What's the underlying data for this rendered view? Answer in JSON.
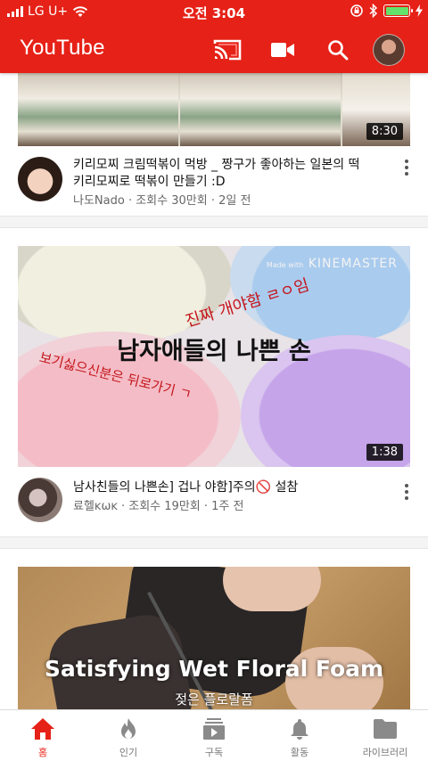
{
  "status_bar": {
    "carrier": "LG U+",
    "time": "오전 3:04"
  },
  "app_bar": {
    "title": "YouTube",
    "icons": [
      "cast-icon",
      "camera-icon",
      "search-icon",
      "account-avatar"
    ]
  },
  "colors": {
    "brand_red": "#e62117",
    "text_primary": "#111111",
    "text_secondary": "#666666"
  },
  "videos": [
    {
      "duration": "8:30",
      "title": "키리모찌 크림떡볶이 먹방 _ 짱구가 좋아하는 일본의 떡 키리모찌로 떡볶이 만들기 :D",
      "subtitle": "나도Nado · 조회수 30만회 · 2일 전"
    },
    {
      "duration": "1:38",
      "title": "남사친들의 나쁜손] 겁나 야함]주의🚫 설참",
      "subtitle": "료헬ĸωĸ · 조회수 19만회 · 1주 전",
      "thumbnail_text": {
        "main": "남자애들의 나쁜 손",
        "red_top": "진짜 개야함 ㄹㅇ임",
        "red_left": "보기싫으신분은 뒤로가기 ㄱ",
        "watermark_small": "Made with",
        "watermark": "KINEMASTER"
      }
    },
    {
      "thumbnail_text": {
        "main": "Satisfying Wet Floral Foam",
        "sub": "젖은 플로랄폼"
      }
    }
  ],
  "bottom_nav": [
    {
      "label": "홈",
      "icon": "home-icon",
      "active": true
    },
    {
      "label": "인기",
      "icon": "flame-icon",
      "active": false
    },
    {
      "label": "구독",
      "icon": "subscriptions-icon",
      "active": false
    },
    {
      "label": "활동",
      "icon": "bell-icon",
      "active": false
    },
    {
      "label": "라이브러리",
      "icon": "folder-icon",
      "active": false
    }
  ]
}
